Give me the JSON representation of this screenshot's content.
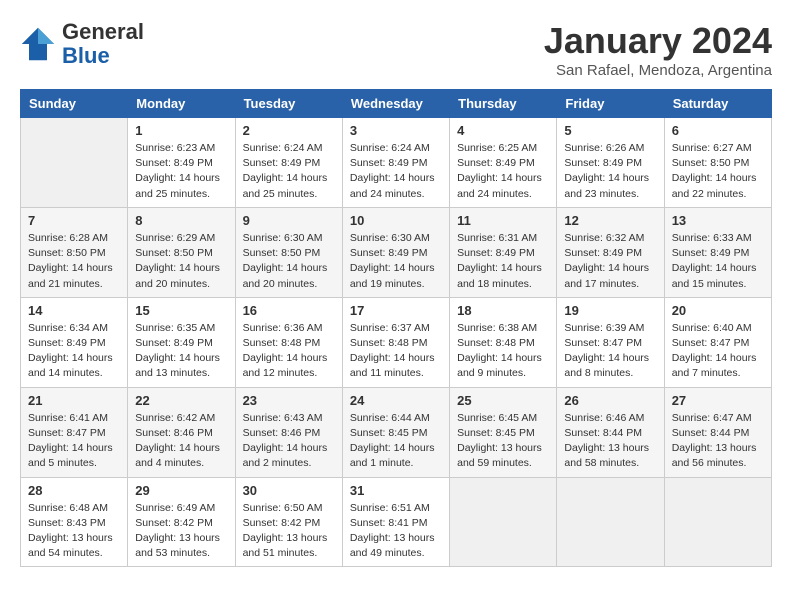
{
  "header": {
    "logo": {
      "general": "General",
      "blue": "Blue"
    },
    "title": "January 2024",
    "subtitle": "San Rafael, Mendoza, Argentina"
  },
  "columns": [
    "Sunday",
    "Monday",
    "Tuesday",
    "Wednesday",
    "Thursday",
    "Friday",
    "Saturday"
  ],
  "weeks": [
    [
      {
        "day": "",
        "info": ""
      },
      {
        "day": "1",
        "info": "Sunrise: 6:23 AM\nSunset: 8:49 PM\nDaylight: 14 hours\nand 25 minutes."
      },
      {
        "day": "2",
        "info": "Sunrise: 6:24 AM\nSunset: 8:49 PM\nDaylight: 14 hours\nand 25 minutes."
      },
      {
        "day": "3",
        "info": "Sunrise: 6:24 AM\nSunset: 8:49 PM\nDaylight: 14 hours\nand 24 minutes."
      },
      {
        "day": "4",
        "info": "Sunrise: 6:25 AM\nSunset: 8:49 PM\nDaylight: 14 hours\nand 24 minutes."
      },
      {
        "day": "5",
        "info": "Sunrise: 6:26 AM\nSunset: 8:49 PM\nDaylight: 14 hours\nand 23 minutes."
      },
      {
        "day": "6",
        "info": "Sunrise: 6:27 AM\nSunset: 8:50 PM\nDaylight: 14 hours\nand 22 minutes."
      }
    ],
    [
      {
        "day": "7",
        "info": "Sunrise: 6:28 AM\nSunset: 8:50 PM\nDaylight: 14 hours\nand 21 minutes."
      },
      {
        "day": "8",
        "info": "Sunrise: 6:29 AM\nSunset: 8:50 PM\nDaylight: 14 hours\nand 20 minutes."
      },
      {
        "day": "9",
        "info": "Sunrise: 6:30 AM\nSunset: 8:50 PM\nDaylight: 14 hours\nand 20 minutes."
      },
      {
        "day": "10",
        "info": "Sunrise: 6:30 AM\nSunset: 8:49 PM\nDaylight: 14 hours\nand 19 minutes."
      },
      {
        "day": "11",
        "info": "Sunrise: 6:31 AM\nSunset: 8:49 PM\nDaylight: 14 hours\nand 18 minutes."
      },
      {
        "day": "12",
        "info": "Sunrise: 6:32 AM\nSunset: 8:49 PM\nDaylight: 14 hours\nand 17 minutes."
      },
      {
        "day": "13",
        "info": "Sunrise: 6:33 AM\nSunset: 8:49 PM\nDaylight: 14 hours\nand 15 minutes."
      }
    ],
    [
      {
        "day": "14",
        "info": "Sunrise: 6:34 AM\nSunset: 8:49 PM\nDaylight: 14 hours\nand 14 minutes."
      },
      {
        "day": "15",
        "info": "Sunrise: 6:35 AM\nSunset: 8:49 PM\nDaylight: 14 hours\nand 13 minutes."
      },
      {
        "day": "16",
        "info": "Sunrise: 6:36 AM\nSunset: 8:48 PM\nDaylight: 14 hours\nand 12 minutes."
      },
      {
        "day": "17",
        "info": "Sunrise: 6:37 AM\nSunset: 8:48 PM\nDaylight: 14 hours\nand 11 minutes."
      },
      {
        "day": "18",
        "info": "Sunrise: 6:38 AM\nSunset: 8:48 PM\nDaylight: 14 hours\nand 9 minutes."
      },
      {
        "day": "19",
        "info": "Sunrise: 6:39 AM\nSunset: 8:47 PM\nDaylight: 14 hours\nand 8 minutes."
      },
      {
        "day": "20",
        "info": "Sunrise: 6:40 AM\nSunset: 8:47 PM\nDaylight: 14 hours\nand 7 minutes."
      }
    ],
    [
      {
        "day": "21",
        "info": "Sunrise: 6:41 AM\nSunset: 8:47 PM\nDaylight: 14 hours\nand 5 minutes."
      },
      {
        "day": "22",
        "info": "Sunrise: 6:42 AM\nSunset: 8:46 PM\nDaylight: 14 hours\nand 4 minutes."
      },
      {
        "day": "23",
        "info": "Sunrise: 6:43 AM\nSunset: 8:46 PM\nDaylight: 14 hours\nand 2 minutes."
      },
      {
        "day": "24",
        "info": "Sunrise: 6:44 AM\nSunset: 8:45 PM\nDaylight: 14 hours\nand 1 minute."
      },
      {
        "day": "25",
        "info": "Sunrise: 6:45 AM\nSunset: 8:45 PM\nDaylight: 13 hours\nand 59 minutes."
      },
      {
        "day": "26",
        "info": "Sunrise: 6:46 AM\nSunset: 8:44 PM\nDaylight: 13 hours\nand 58 minutes."
      },
      {
        "day": "27",
        "info": "Sunrise: 6:47 AM\nSunset: 8:44 PM\nDaylight: 13 hours\nand 56 minutes."
      }
    ],
    [
      {
        "day": "28",
        "info": "Sunrise: 6:48 AM\nSunset: 8:43 PM\nDaylight: 13 hours\nand 54 minutes."
      },
      {
        "day": "29",
        "info": "Sunrise: 6:49 AM\nSunset: 8:42 PM\nDaylight: 13 hours\nand 53 minutes."
      },
      {
        "day": "30",
        "info": "Sunrise: 6:50 AM\nSunset: 8:42 PM\nDaylight: 13 hours\nand 51 minutes."
      },
      {
        "day": "31",
        "info": "Sunrise: 6:51 AM\nSunset: 8:41 PM\nDaylight: 13 hours\nand 49 minutes."
      },
      {
        "day": "",
        "info": ""
      },
      {
        "day": "",
        "info": ""
      },
      {
        "day": "",
        "info": ""
      }
    ]
  ]
}
